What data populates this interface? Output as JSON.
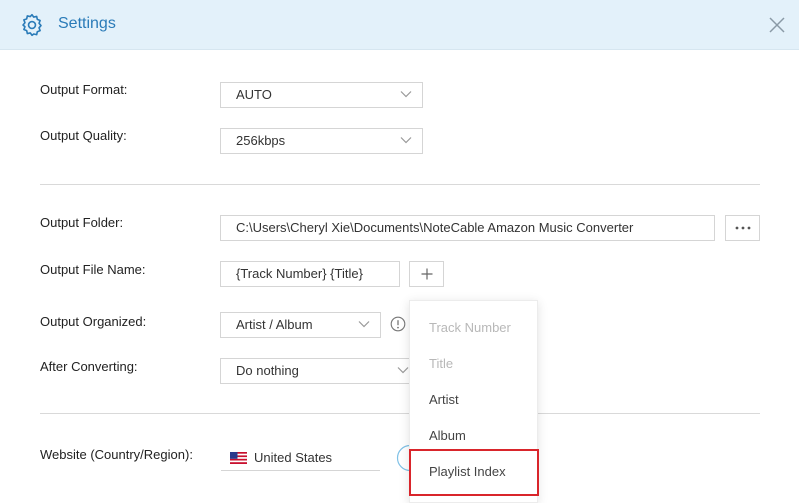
{
  "window": {
    "title": "Settings"
  },
  "icons": {
    "settings": "gear-icon",
    "close": "close-icon",
    "chevron": "chevron-down-icon",
    "more": "more-dots-icon",
    "add": "plus-icon",
    "info": "info-icon",
    "flag": "us-flag-icon"
  },
  "settings": {
    "output_format": {
      "label": "Output Format:",
      "value": "AUTO"
    },
    "output_quality": {
      "label": "Output Quality:",
      "value": "256kbps"
    },
    "output_folder": {
      "label": "Output Folder:",
      "value": "C:\\Users\\Cheryl Xie\\Documents\\NoteCable Amazon Music Converter"
    },
    "output_file_name": {
      "label": "Output File Name:",
      "value": "{Track Number} {Title}"
    },
    "output_organized": {
      "label": "Output Organized:",
      "value": "Artist / Album"
    },
    "after_converting": {
      "label": "After Converting:",
      "value": "Do nothing"
    },
    "website": {
      "label": "Website (Country/Region):",
      "value": "United States"
    }
  },
  "filename_dropdown": {
    "items": [
      {
        "label": "Track Number",
        "disabled": true
      },
      {
        "label": "Title",
        "disabled": true
      },
      {
        "label": "Artist",
        "disabled": false
      },
      {
        "label": "Album",
        "disabled": false
      },
      {
        "label": "Playlist Index",
        "disabled": false,
        "highlighted": true
      }
    ]
  },
  "colors": {
    "accent": "#2a7bb8",
    "titlebar_bg": "#e3f1fa",
    "highlight_border": "#d9252b",
    "disabled_text": "#b8b8b8"
  }
}
